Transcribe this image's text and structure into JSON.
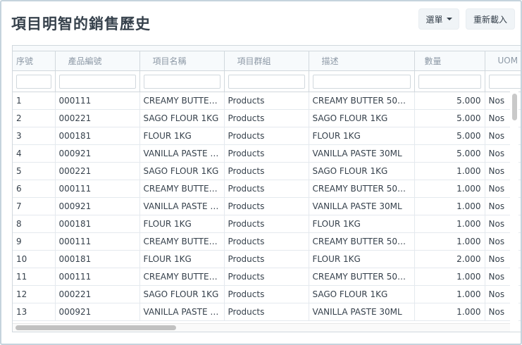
{
  "header": {
    "title": "項目明智的銷售歷史",
    "menu_label": "選單",
    "reload_label": "重新載入"
  },
  "table": {
    "columns": [
      "序號",
      "產品編號",
      "項目名稱",
      "項目群組",
      "描述",
      "數量",
      "UOM"
    ],
    "rows": [
      [
        "1",
        "000111",
        "CREAMY BUTTER...",
        "Products",
        "CREAMY BUTTER 500...",
        "5.000",
        "Nos"
      ],
      [
        "2",
        "000221",
        "SAGO FLOUR 1KG",
        "Products",
        "SAGO FLOUR 1KG",
        "5.000",
        "Nos"
      ],
      [
        "3",
        "000181",
        "FLOUR 1KG",
        "Products",
        "FLOUR 1KG",
        "5.000",
        "Nos"
      ],
      [
        "4",
        "000921",
        "VANILLA PASTE 3...",
        "Products",
        "VANILLA PASTE 30ML",
        "5.000",
        "Nos"
      ],
      [
        "5",
        "000221",
        "SAGO FLOUR 1KG",
        "Products",
        "SAGO FLOUR 1KG",
        "1.000",
        "Nos"
      ],
      [
        "6",
        "000111",
        "CREAMY BUTTER...",
        "Products",
        "CREAMY BUTTER 500...",
        "1.000",
        "Nos"
      ],
      [
        "7",
        "000921",
        "VANILLA PASTE 3...",
        "Products",
        "VANILLA PASTE 30ML",
        "1.000",
        "Nos"
      ],
      [
        "8",
        "000181",
        "FLOUR 1KG",
        "Products",
        "FLOUR 1KG",
        "1.000",
        "Nos"
      ],
      [
        "9",
        "000111",
        "CREAMY BUTTER...",
        "Products",
        "CREAMY BUTTER 500...",
        "1.000",
        "Nos"
      ],
      [
        "10",
        "000181",
        "FLOUR 1KG",
        "Products",
        "FLOUR 1KG",
        "2.000",
        "Nos"
      ],
      [
        "11",
        "000111",
        "CREAMY BUTTER...",
        "Products",
        "CREAMY BUTTER 500...",
        "1.000",
        "Nos"
      ],
      [
        "12",
        "000221",
        "SAGO FLOUR 1KG",
        "Products",
        "SAGO FLOUR 1KG",
        "1.000",
        "Nos"
      ],
      [
        "13",
        "000921",
        "VANILLA PASTE 3...",
        "Products",
        "VANILLA PASTE 30ML",
        "1.000",
        "Nos"
      ]
    ]
  }
}
